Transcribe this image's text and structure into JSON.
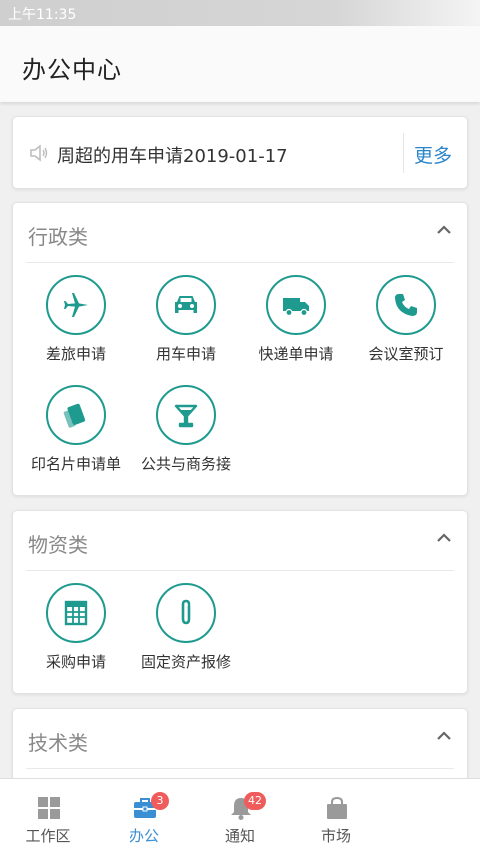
{
  "status_bar": {
    "time": "上午11:35"
  },
  "header": {
    "title": "办公中心"
  },
  "notice": {
    "text": "周超的用车申请2019-01-17",
    "more_label": "更多"
  },
  "categories": [
    {
      "title": "行政类",
      "items": [
        {
          "label": "差旅申请",
          "icon": "airplane-icon"
        },
        {
          "label": "用车申请",
          "icon": "car-icon"
        },
        {
          "label": "快递单申请",
          "icon": "truck-icon"
        },
        {
          "label": "会议室预订",
          "icon": "phone-icon"
        },
        {
          "label": "印名片申请单",
          "icon": "cards-icon"
        },
        {
          "label": "公共与商务接",
          "icon": "cocktail-icon"
        }
      ]
    },
    {
      "title": "物资类",
      "items": [
        {
          "label": "采购申请",
          "icon": "spreadsheet-icon"
        },
        {
          "label": "固定资产报修",
          "icon": "paperclip-icon"
        }
      ]
    },
    {
      "title": "技术类",
      "items": []
    }
  ],
  "tabs": [
    {
      "label": "工作区",
      "icon": "grid-icon",
      "active": false
    },
    {
      "label": "办公",
      "icon": "briefcase-icon",
      "active": true,
      "badge": "3"
    },
    {
      "label": "通知",
      "icon": "bell-icon",
      "active": false,
      "badge": "42"
    },
    {
      "label": "市场",
      "icon": "shopping-bag-icon",
      "active": false
    }
  ],
  "colors": {
    "accent": "#1e9a8f",
    "link": "#2a86c9",
    "active_tab": "#3a8fd4",
    "badge": "#f05c5c"
  }
}
